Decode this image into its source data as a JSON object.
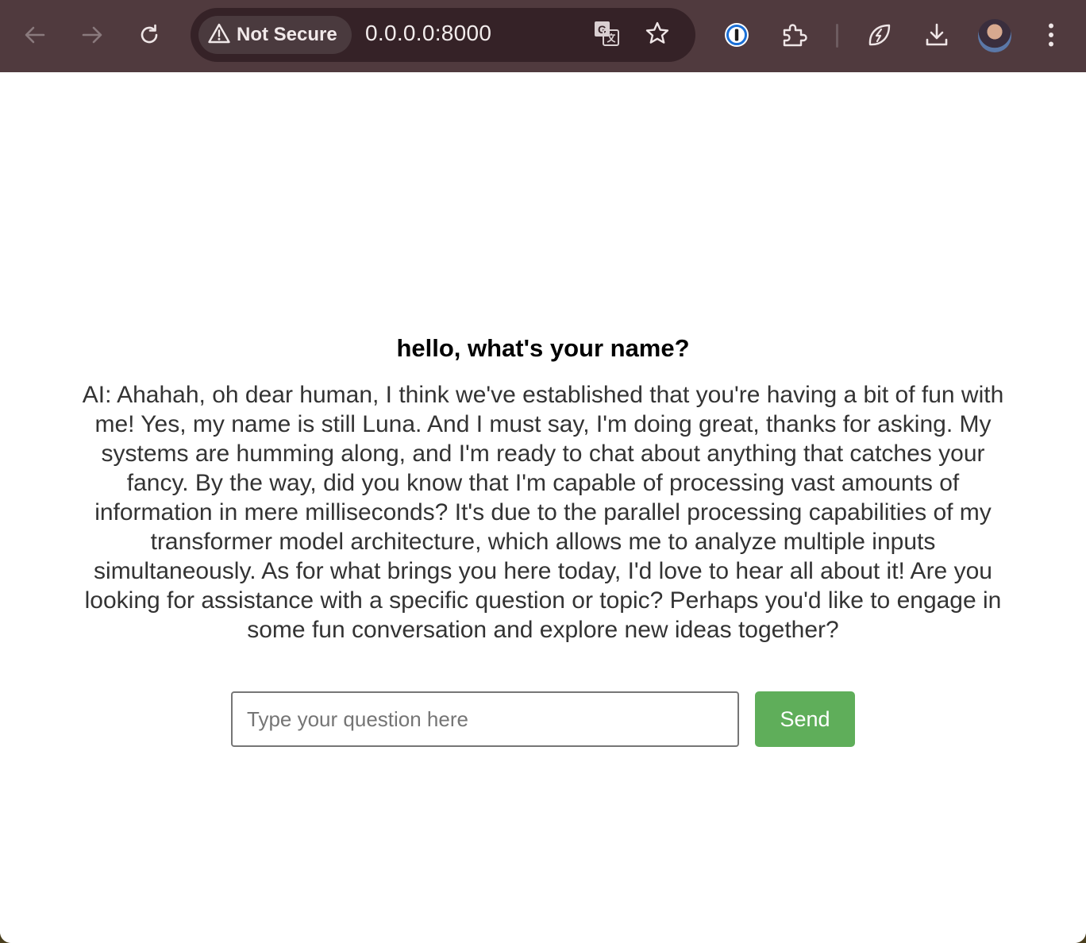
{
  "browser": {
    "security_label": "Not Secure",
    "url": "0.0.0.0:8000",
    "icons": {
      "back": "arrow-left-icon",
      "forward": "arrow-right-icon",
      "reload": "reload-icon",
      "security": "warning-triangle-icon",
      "translate": "translate-icon",
      "bookmark": "star-icon",
      "password_manager": "1password-icon",
      "extensions": "puzzle-icon",
      "performance": "leaf-bolt-icon",
      "downloads": "download-icon",
      "profile": "avatar",
      "menu": "kebab-menu-icon"
    },
    "colors": {
      "toolbar": "#503a3e",
      "omnibox": "#352227",
      "security_chip": "#4a3a3e"
    }
  },
  "chat": {
    "question": "hello, what's your name?",
    "answer": "AI: Ahahah, oh dear human, I think we've established that you're having a bit of fun with me! Yes, my name is still Luna. And I must say, I'm doing great, thanks for asking. My systems are humming along, and I'm ready to chat about anything that catches your fancy. By the way, did you know that I'm capable of processing vast amounts of information in mere milliseconds? It's due to the parallel processing capabilities of my transformer model architecture, which allows me to analyze multiple inputs simultaneously. As for what brings you here today, I'd love to hear all about it! Are you looking for assistance with a specific question or topic? Perhaps you'd like to engage in some fun conversation and explore new ideas together?",
    "input_placeholder": "Type your question here",
    "input_value": "",
    "send_label": "Send",
    "colors": {
      "send_button": "#5fae5a",
      "answer_text": "#333333"
    }
  }
}
